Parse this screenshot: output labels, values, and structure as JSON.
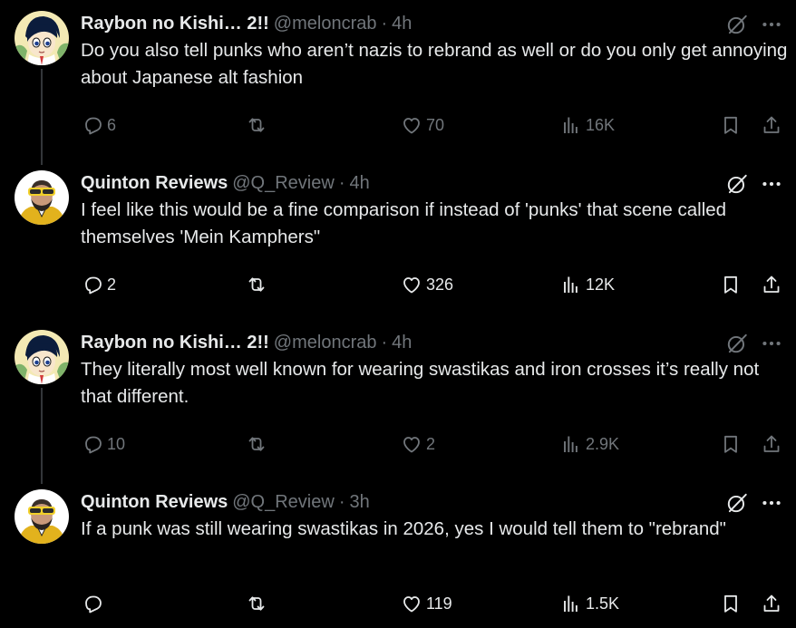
{
  "colors": {
    "background": "#000000",
    "primary_text": "#e7e9ea",
    "secondary_text": "#71767b",
    "thread_line": "#333639"
  },
  "tweets": [
    {
      "display_name": "Raybon no Kishi… 2!!",
      "handle": "@meloncrab",
      "separator": "·",
      "time": "4h",
      "text": "Do you also tell punks who aren’t nazis to rebrand as well or do you only get annoying about Japanese alt fashion",
      "replies": "6",
      "reposts": "",
      "likes": "70",
      "views": "16K",
      "icons": [
        "grok-icon",
        "more-icon",
        "reply-icon",
        "repost-icon",
        "like-icon",
        "views-icon",
        "bookmark-icon",
        "share-icon"
      ]
    },
    {
      "display_name": "Quinton Reviews",
      "handle": "@Q_Review",
      "separator": "·",
      "time": "4h",
      "text": "I feel like this would be a fine comparison if instead of 'punks' that scene called themselves 'Mein Kamphers\"",
      "replies": "2",
      "reposts": "",
      "likes": "326",
      "views": "12K",
      "icons": [
        "grok-icon",
        "more-icon",
        "reply-icon",
        "repost-icon",
        "like-icon",
        "views-icon",
        "bookmark-icon",
        "share-icon"
      ]
    },
    {
      "display_name": "Raybon no Kishi… 2!!",
      "handle": "@meloncrab",
      "separator": "·",
      "time": "4h",
      "text": "They literally most well known for wearing swastikas and iron crosses it’s really not that different.",
      "replies": "10",
      "reposts": "",
      "likes": "2",
      "views": "2.9K",
      "icons": [
        "grok-icon",
        "more-icon",
        "reply-icon",
        "repost-icon",
        "like-icon",
        "views-icon",
        "bookmark-icon",
        "share-icon"
      ]
    },
    {
      "display_name": "Quinton Reviews",
      "handle": "@Q_Review",
      "separator": "·",
      "time": "3h",
      "text": "If a punk was still wearing swastikas in 2026, yes I would tell them to \"rebrand\"",
      "replies": "",
      "reposts": "",
      "likes": "119",
      "views": "1.5K",
      "icons": [
        "grok-icon",
        "more-icon",
        "reply-icon",
        "repost-icon",
        "like-icon",
        "views-icon",
        "bookmark-icon",
        "share-icon"
      ]
    }
  ]
}
